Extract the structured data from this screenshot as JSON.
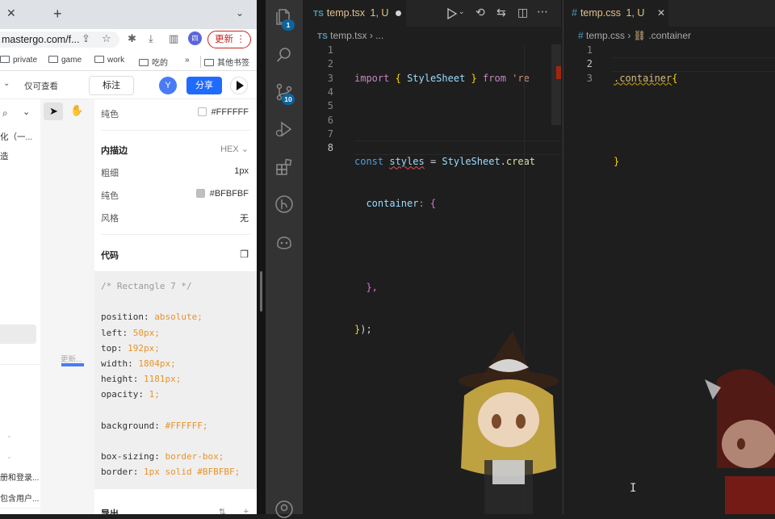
{
  "browser": {
    "url": "mastergo.com/f...",
    "update_label": "更新",
    "bookmarks": [
      "private",
      "game",
      "work",
      "吃的",
      "»",
      "其他书签"
    ],
    "profile_badge": "四"
  },
  "mastergo": {
    "view_only": "仅可查看",
    "annotate_label": "标注",
    "avatar_initial": "Y",
    "share_label": "分享",
    "left_items": [
      "化（一...",
      "造"
    ],
    "left_bottom_items": [
      "册和登录...",
      "包含用户..."
    ],
    "canvas_label": "更新...",
    "inspector": {
      "fill_label": "纯色",
      "fill_value": "#FFFFFF",
      "stroke_section": "内描边",
      "stroke_format": "HEX",
      "thickness_label": "粗细",
      "thickness_value": "1px",
      "stroke_fill_label": "纯色",
      "stroke_fill_value": "#BFBFBF",
      "style_label": "风格",
      "style_value": "无",
      "code_section": "代码",
      "export_label": "导出"
    },
    "code_lines": [
      {
        "k": "/* Rectangle 7 */",
        "v": ""
      },
      {
        "k": "",
        "v": ""
      },
      {
        "k": "position: ",
        "v": "absolute;"
      },
      {
        "k": "left: ",
        "v": "50px;"
      },
      {
        "k": "top: ",
        "v": "192px;"
      },
      {
        "k": "width: ",
        "v": "1804px;"
      },
      {
        "k": "height: ",
        "v": "1181px;"
      },
      {
        "k": "opacity: ",
        "v": "1;"
      },
      {
        "k": "",
        "v": ""
      },
      {
        "k": "background: ",
        "v": "#FFFFFF;"
      },
      {
        "k": "",
        "v": ""
      },
      {
        "k": "box-sizing: ",
        "v": "border-box;"
      },
      {
        "k": "border: ",
        "v": "1px solid #BFBFBF;"
      }
    ]
  },
  "vscode": {
    "activity_badges": {
      "explorer": "1",
      "scm": "10"
    },
    "editor1": {
      "tab_lang": "TS",
      "tab_name": "temp.tsx",
      "tab_status": "1, U",
      "crumb_lang": "TS",
      "crumb_file": "temp.tsx",
      "crumb_more": "...",
      "line_numbers": [
        "1",
        "2",
        "3",
        "4",
        "5",
        "6",
        "7",
        "8"
      ],
      "code": {
        "l1_import": "import",
        "l1_open": "{",
        "l1_name": "StyleSheet",
        "l1_close": "}",
        "l1_from": "from",
        "l1_str": "'re",
        "l3_const": "const",
        "l3_var": "styles",
        "l3_eq": "=",
        "l3_cls": "StyleSheet",
        "l3_fn": ".creat",
        "l4_prop": "container",
        "l4_brace": ": {",
        "l6": "},",
        "l7_close": "}",
        "l7_rest": ");"
      }
    },
    "editor2": {
      "tab_icon": "#",
      "tab_name": "temp.css",
      "tab_status": "1, U",
      "crumb_icon": "#",
      "crumb_file": "temp.css",
      "crumb_selector": ".container",
      "line_numbers": [
        "1",
        "2",
        "3"
      ],
      "l1_selector": ".container",
      "l1_brace": "{",
      "l3_brace": "}"
    }
  },
  "colors": {
    "accent_blue": "#1f6bff",
    "vscode_bg": "#1e1e1e",
    "activity_bg": "#333333",
    "modified_tab": "#e2c08d"
  }
}
